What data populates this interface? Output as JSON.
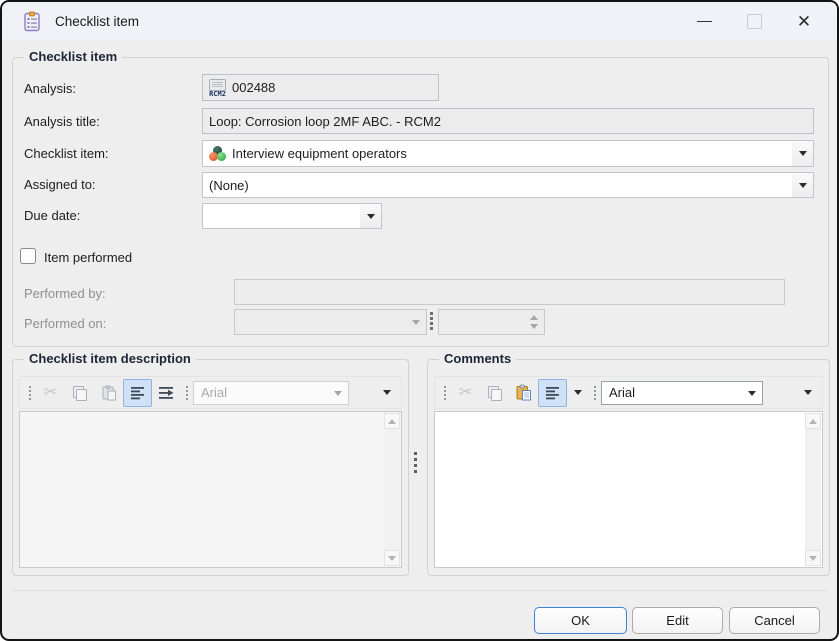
{
  "window": {
    "title": "Checklist item"
  },
  "group1": {
    "title": "Checklist item",
    "analysis": {
      "label": "Analysis:",
      "value": "002488",
      "badge": "RCM2"
    },
    "analysis_title": {
      "label": "Analysis title:",
      "value": "Loop: Corrosion loop 2MF ABC. - RCM2"
    },
    "checklist_item": {
      "label": "Checklist item:",
      "value": "Interview equipment operators"
    },
    "assigned_to": {
      "label": "Assigned to:",
      "value": "(None)"
    },
    "due_date": {
      "label": "Due date:",
      "value": ""
    },
    "item_performed": {
      "label": "Item performed",
      "checked": false
    },
    "performed_by": {
      "label": "Performed by:",
      "value": ""
    },
    "performed_on": {
      "label": "Performed on:",
      "date_value": "",
      "time_value": ""
    }
  },
  "description_group": {
    "title": "Checklist item description",
    "toolbar": {
      "font": "Arial"
    },
    "text": ""
  },
  "comments_group": {
    "title": "Comments",
    "toolbar": {
      "font": "Arial"
    },
    "text": ""
  },
  "buttons": {
    "ok": "OK",
    "edit": "Edit",
    "cancel": "Cancel"
  }
}
